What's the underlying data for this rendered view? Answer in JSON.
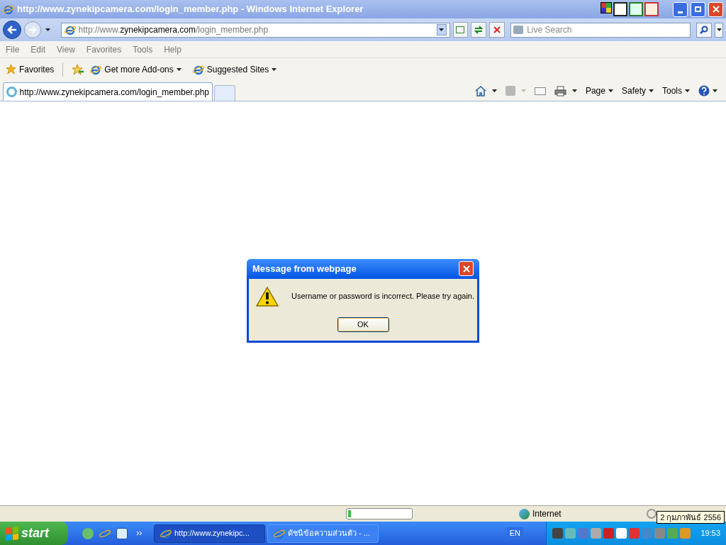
{
  "window": {
    "title": "http://www.zynekipcamera.com/login_member.php - Windows Internet Explorer"
  },
  "address": {
    "prefix": "http://www.",
    "domain": "zynekipcamera.com",
    "path": "/login_member.php"
  },
  "search": {
    "placeholder": "Live Search"
  },
  "menu": [
    "File",
    "Edit",
    "View",
    "Favorites",
    "Tools",
    "Help"
  ],
  "favorites_bar": {
    "favorites": "Favorites",
    "links": [
      {
        "label": "Get more Add-ons"
      },
      {
        "label": "Suggested Sites"
      }
    ]
  },
  "tabs": [
    {
      "label": "http://www.zynekipcamera.com/login_member.php",
      "selected": true
    }
  ],
  "command_bar": [
    "Page",
    "Safety",
    "Tools"
  ],
  "dialog": {
    "title": "Message from webpage",
    "message": "Username or password is incorrect. Please try again.",
    "button": "OK"
  },
  "status_bar": {
    "progress": {
      "level": 0.05
    },
    "zone": "Internet"
  },
  "taskbar": {
    "start": "start",
    "tasks": [
      {
        "label": "http://www.zynekipc...",
        "selected": true
      },
      {
        "label": "ดัชนีข้อความส่วนตัว - ...",
        "selected": false
      }
    ],
    "language": "EN",
    "clock": "19:53",
    "tooltip": "2 กุมภาพันธ์ 2556"
  }
}
